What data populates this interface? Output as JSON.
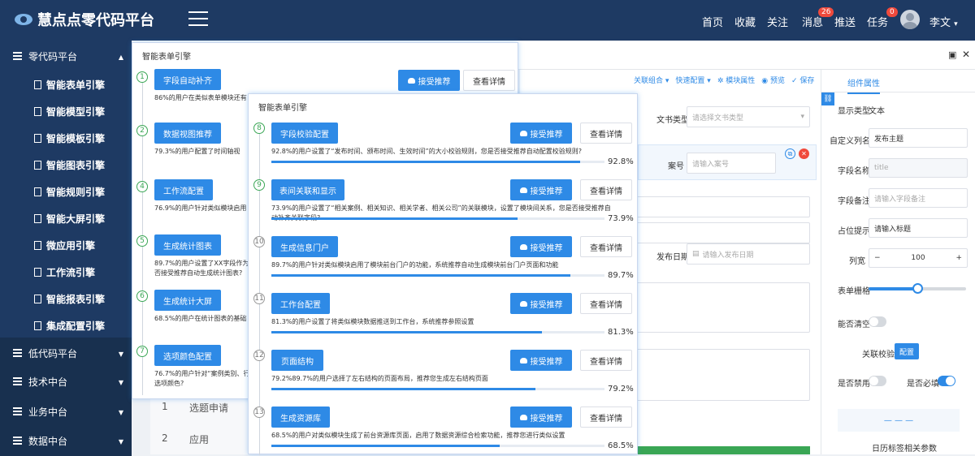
{
  "header": {
    "app_title": "慧点点零代码平台",
    "nav": [
      "首页",
      "收藏",
      "关注",
      "消息",
      "推送",
      "任务"
    ],
    "message_badge": "26",
    "task_badge": "0",
    "user_name": "李文"
  },
  "sidebar": {
    "groups": [
      {
        "label": "零代码平台",
        "expanded": true
      },
      {
        "label": "低代码平台"
      },
      {
        "label": "技术中台"
      },
      {
        "label": "业务中台"
      },
      {
        "label": "数据中台"
      }
    ],
    "items": [
      "智能表单引擎",
      "智能模型引擎",
      "智能模板引擎",
      "智能图表引擎",
      "智能规则引擎",
      "智能大屏引擎",
      "微应用引擎",
      "工作流引擎",
      "智能报表引擎",
      "集成配置引擎"
    ]
  },
  "toolbar": {
    "actions": [
      "关联组合",
      "快速配置",
      "模块属性",
      "预览",
      "保存"
    ]
  },
  "form": {
    "doc_type_label": "文书类型",
    "doc_type_placeholder": "请选择文书类型",
    "case_no_label": "案号",
    "case_no_placeholder": "请输入案号",
    "publish_date_label": "发布日期",
    "publish_date_placeholder": "请输入发布日期"
  },
  "right_panel": {
    "tab": "组件属性",
    "display_type_label": "显示类型",
    "display_type_value": "文本",
    "custom_name_label": "自定义列名",
    "custom_name_value": "发布主题",
    "field_name_label": "字段名称",
    "field_name_value": "title",
    "field_note_label": "字段备注",
    "field_note_placeholder": "请输入字段备注",
    "placeholder_label": "占位提示",
    "placeholder_value": "请输入标题",
    "width_label": "列宽",
    "width_value": "100",
    "width_minus": "−",
    "width_plus": "+",
    "grid_label": "表单栅格",
    "grid_level": 0.5,
    "clearable_label": "能否清空",
    "linked_check_label": "关联校验",
    "config_button": "配置",
    "disabled_label": "是否禁用",
    "required_label": "是否必填",
    "bottom_text": "日历标签相关参数"
  },
  "table": {
    "rows": [
      {
        "index": "1",
        "name": "选题申请"
      },
      {
        "index": "2",
        "name": "应用"
      }
    ]
  },
  "popup_left": {
    "title": "智能表单引擎",
    "accept_label": "接受推荐",
    "detail_label": "查看详情",
    "cards": [
      {
        "num": "1",
        "label": "字段自动补齐",
        "desc": "86%的用户在类似表单模块还有"
      },
      {
        "num": "2",
        "label": "数据视图推荐",
        "desc": "79.3%的用户配置了时间轴视图，"
      },
      {
        "num": "4",
        "label": "工作流配置",
        "desc": "76.9%的用户针对类似模块启用了"
      },
      {
        "num": "5",
        "label": "生成统计图表",
        "desc": "89.7%的用户设置了XX字段作为统计",
        "desc2": "否接受推荐自动生成统计图表?"
      },
      {
        "num": "6",
        "label": "生成统计大屏",
        "desc": "68.5%的用户在统计图表的基础上"
      },
      {
        "num": "7",
        "label": "选项颜色配置",
        "desc": "76.7%的用户针对“案例类别、行",
        "desc2": "选项颜色?"
      }
    ]
  },
  "popup_right": {
    "title": "智能表单引擎",
    "accept_label": "接受推荐",
    "detail_label": "查看详情",
    "cards": [
      {
        "num": "8",
        "label": "字段校验配置",
        "desc": "92.8%的用户设置了“发布时间、颁布时间、生效时间”的大小校验规则，您是否接受推荐自动配置校验规则?",
        "pct": "92.8%",
        "value": 92.8
      },
      {
        "num": "9",
        "label": "表间关联和显示",
        "desc": "73.9%的用户设置了“相关案例、相关知识、相关学者、相关公司”的关联模块，设置了模块间关系，您是否接受推荐自动补齐关联字段?",
        "pct": "73.9%",
        "value": 73.9
      },
      {
        "num": "10",
        "label": "生成信息门户",
        "desc": "89.7%的用户针对类似模块启用了模块前台门户的功能，系统推荐自动生成模块前台门户页面和功能",
        "pct": "89.7%",
        "value": 89.7
      },
      {
        "num": "11",
        "label": "工作台配置",
        "desc": "81.3%的用户设置了将类似模块数据推送到工作台，系统推荐参照设置",
        "pct": "81.3%",
        "value": 81.3
      },
      {
        "num": "12",
        "label": "页面结构",
        "desc": "79.2%89.7%的用户选择了左右结构的页面布局，推荐您生成左右结构页面",
        "pct": "79.2%",
        "value": 79.2
      },
      {
        "num": "13",
        "label": "生成资源库",
        "desc": "68.5%的用户对类似模块生成了前台资源库页面，启用了数据资源综合检索功能，推荐您进行类似设置",
        "pct": "68.5%",
        "value": 68.5
      }
    ]
  },
  "colors": {
    "primary": "#2e8ae6",
    "header": "#1e3a63",
    "step_green": "#3aa655",
    "danger": "#f04a3c"
  }
}
